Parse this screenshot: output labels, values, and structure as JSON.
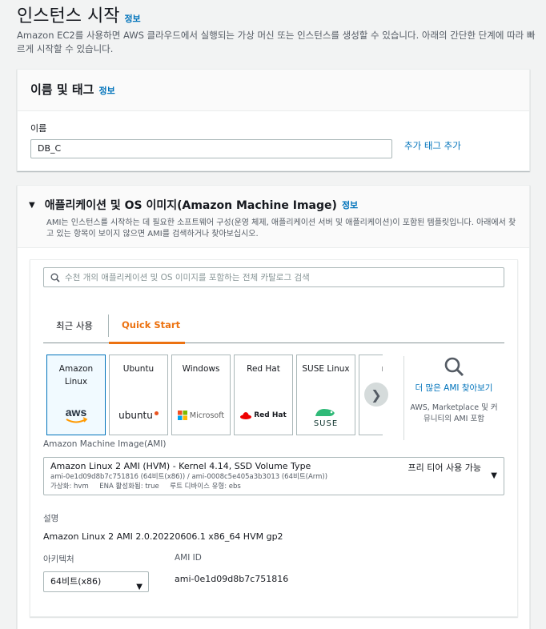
{
  "page": {
    "title": "인스턴스 시작",
    "info": "정보",
    "description": "Amazon EC2를 사용하면 AWS 클라우드에서 실행되는 가상 머신 또는 인스턴스를 생성할 수 있습니다. 아래의 간단한 단계에 따라 빠르게 시작할 수 있습니다."
  },
  "name_tags": {
    "title": "이름 및 태그",
    "info": "정보",
    "name_label": "이름",
    "name_value": "DB_C",
    "add_tag": "추가 태그 추가"
  },
  "ami_section": {
    "title": "애플리케이션 및 OS 이미지(Amazon Machine Image)",
    "info": "정보",
    "description": "AMI는 인스턴스를 시작하는 데 필요한 소프트웨어 구성(운영 체제, 애플리케이션 서버 및 애플리케이션)이 포함된 템플릿입니다. 아래에서 찾고 있는 항목이 보이지 않으면 AMI를 검색하거나 찾아보십시오.",
    "search_placeholder": "수천 개의 애플리케이션 및 OS 이미지를 포함하는 전체 카탈로그 검색",
    "tabs": [
      "최근 사용",
      "Quick Start"
    ],
    "tiles": [
      {
        "name": "Amazon Linux",
        "logo": "aws"
      },
      {
        "name": "Ubuntu",
        "logo": "ubuntu"
      },
      {
        "name": "Windows",
        "logo": "Microsoft"
      },
      {
        "name": "Red Hat",
        "logo": "Red Hat"
      },
      {
        "name": "SUSE Linux",
        "logo": "SUSE"
      },
      {
        "name": "ma",
        "logo": ""
      }
    ],
    "more_link": "더 많은 AMI 찾아보기",
    "more_sub": "AWS, Marketplace 및 커뮤니티의 AMI 포함",
    "ami_label": "Amazon Machine Image(AMI)",
    "ami_title": "Amazon Linux 2 AMI (HVM) - Kernel 4.14, SSD Volume Type",
    "ami_ids": "ami-0e1d09d8b7c751816 (64비트(x86)) / ami-0008c5e405a3b3013 (64비트(Arm))",
    "ami_meta": "가상화: hvm     ENA 활성화됨: true     루트 디바이스 유형: ebs",
    "free_tier": "프리 티어 사용 가능",
    "desc_label": "설명",
    "desc_value": "Amazon Linux 2 AMI 2.0.20220606.1 x86_64 HVM gp2",
    "arch_label": "아키텍처",
    "arch_value": "64비트(x86)",
    "amiid_label": "AMI ID",
    "amiid_value": "ami-0e1d09d8b7c751816"
  },
  "colors": {
    "accent": "#ec7211",
    "link": "#0073bb",
    "selected_bg": "#f1faff"
  }
}
